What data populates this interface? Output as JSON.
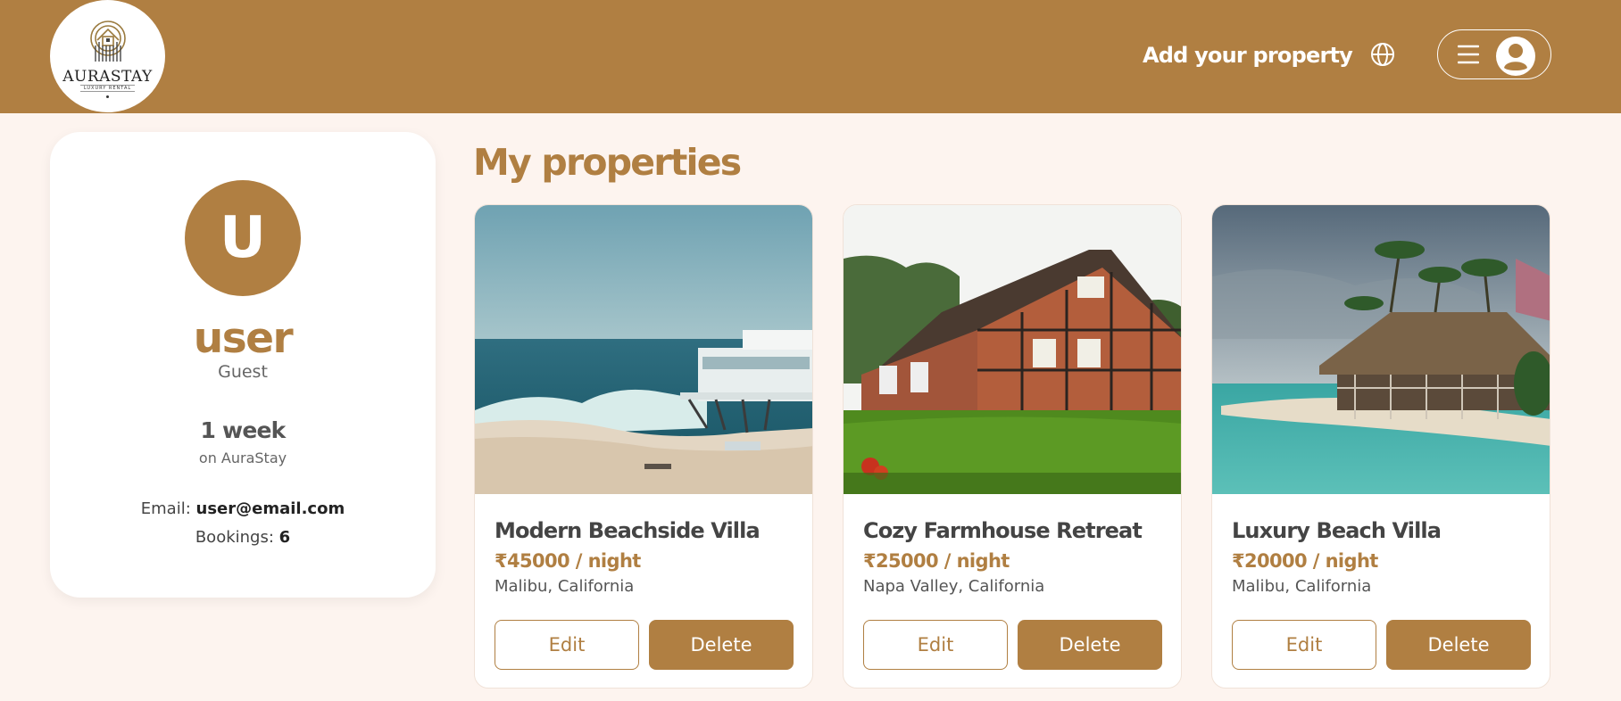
{
  "brand": {
    "name": "AURASTAY",
    "tagline": "LUXURY RENTAL",
    "color": "#b07f42"
  },
  "header": {
    "add_property": "Add your property",
    "globe_icon": "globe-icon",
    "menu_icon": "hamburger-menu-icon",
    "user_icon": "user-avatar-icon"
  },
  "profile": {
    "initial": "U",
    "name": "user",
    "role": "Guest",
    "tenure": "1 week",
    "tenure_sub": "on AuraStay",
    "email_label": "Email:",
    "email": "user@email.com",
    "bookings_label": "Bookings:",
    "bookings": "6"
  },
  "section": {
    "title": "My properties"
  },
  "properties": [
    {
      "title": "Modern Beachside Villa",
      "price": "₹45000 / night",
      "location": "Malibu, California",
      "edit": "Edit",
      "delete": "Delete"
    },
    {
      "title": "Cozy Farmhouse Retreat",
      "price": "₹25000 / night",
      "location": "Napa Valley, California",
      "edit": "Edit",
      "delete": "Delete"
    },
    {
      "title": "Luxury Beach Villa",
      "price": "₹20000 / night",
      "location": "Malibu, California",
      "edit": "Edit",
      "delete": "Delete"
    }
  ]
}
